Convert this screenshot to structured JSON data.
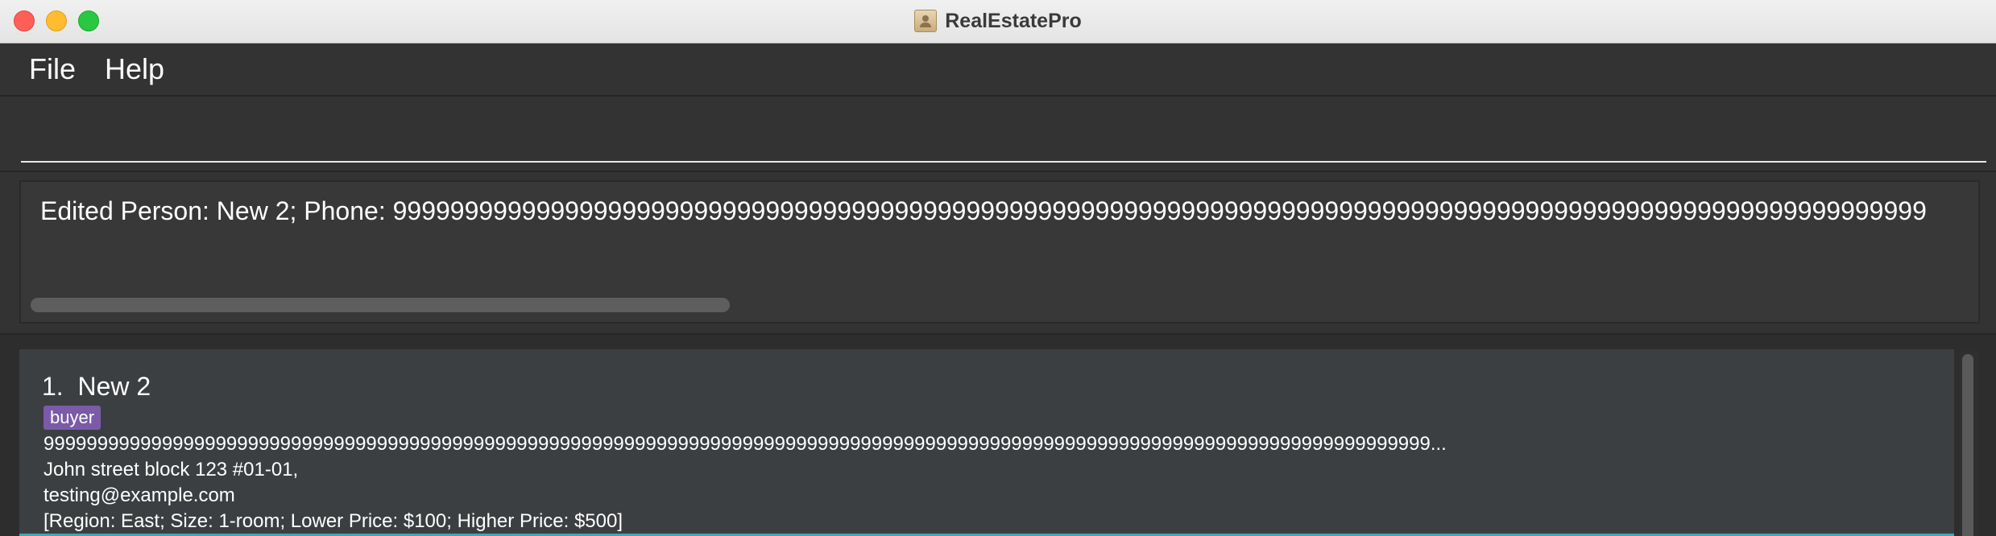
{
  "window": {
    "title": "RealEstatePro",
    "app_icon": "address-book-icon"
  },
  "menu": {
    "items": [
      "File",
      "Help"
    ]
  },
  "command": {
    "value": "",
    "placeholder": ""
  },
  "result": {
    "text": "Edited Person: New 2; Phone: 99999999999999999999999999999999999999999999999999999999999999999999999999999999999999999999999999999999999"
  },
  "persons": [
    {
      "index": "1.",
      "name": "New 2",
      "tag": "buyer",
      "phone": "999999999999999999999999999999999999999999999999999999999999999999999999999999999999999999999999999999999999999999999999999999999...",
      "address": "John street block 123 #01-01,",
      "email": "testing@example.com",
      "preference": "[Region: East; Size: 1-room; Lower Price: $100; Higher Price: $500]"
    }
  ],
  "colors": {
    "tag_bg": "#7b5ba8",
    "selection_accent": "#3fa7b6",
    "background": "#2d2d2d"
  }
}
